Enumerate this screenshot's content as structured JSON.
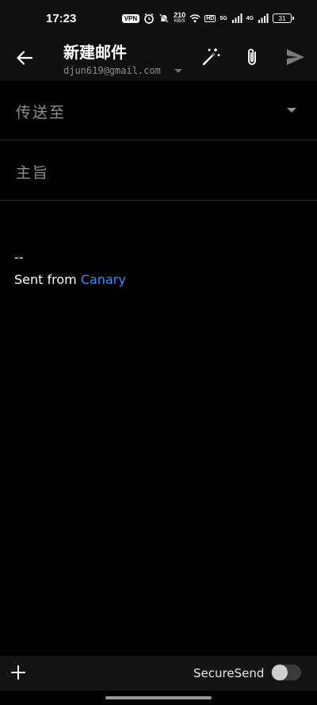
{
  "status_bar": {
    "time": "17:23",
    "vpn": "VPN",
    "speed_value": "210",
    "speed_unit": "KB/S",
    "hd": "HD",
    "net1": "5G",
    "net2": "4G",
    "battery": "31"
  },
  "header": {
    "title": "新建邮件",
    "account_email": "djun619@gmail.com",
    "icons": [
      "back-arrow-icon",
      "magic-wand-icon",
      "paperclip-icon",
      "send-icon"
    ]
  },
  "fields": {
    "to_label": "传送至",
    "subject_label": "主旨"
  },
  "body": {
    "signature_dash": "--",
    "signature_prefix": "Sent from ",
    "signature_link": "Canary"
  },
  "bottom_bar": {
    "secure_send_label": "SecureSend",
    "secure_send_enabled": false
  },
  "colors": {
    "background": "#000000",
    "bar_background": "#101010",
    "link": "#3d8bff",
    "muted": "#8f8f8f"
  }
}
